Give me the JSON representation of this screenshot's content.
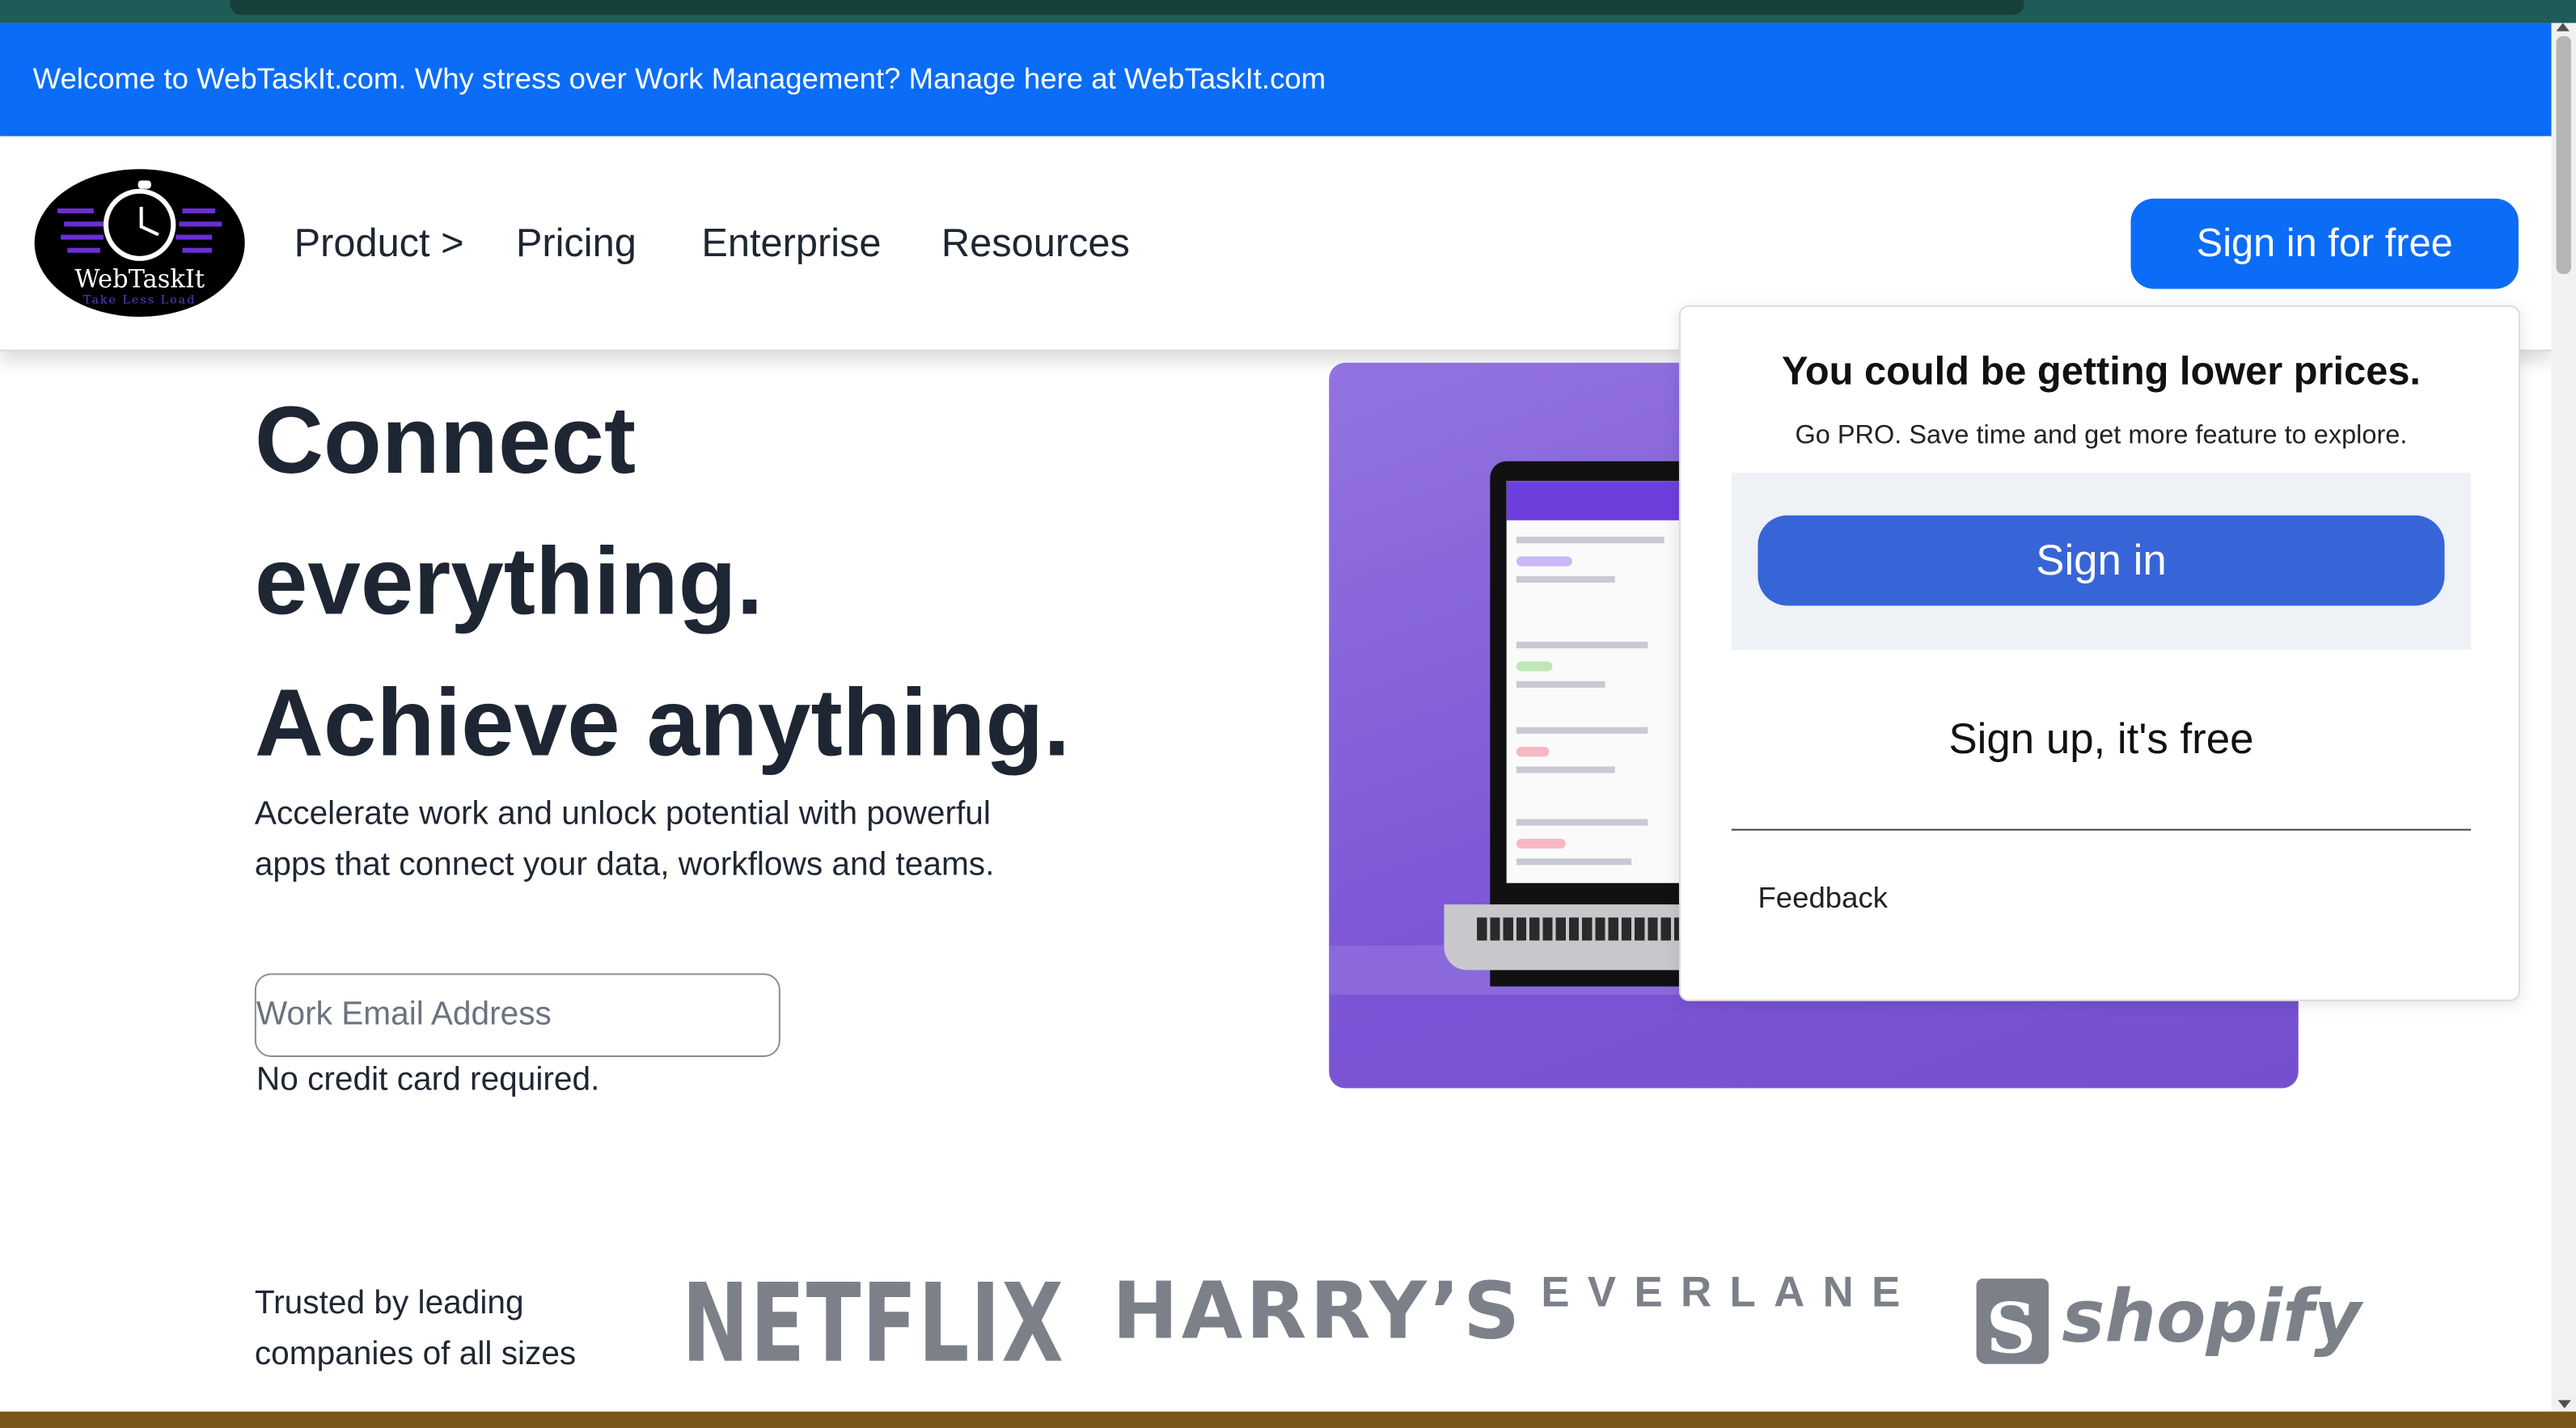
{
  "banner": {
    "text": "Welcome to WebTaskIt.com. Why stress over Work Management? Manage here at WebTaskIt.com"
  },
  "header": {
    "logo_name": "WebTaskIt",
    "logo_tagline": "Take Less Load",
    "nav": {
      "product": "Product >",
      "pricing": "Pricing",
      "enterprise": "Enterprise",
      "resources": "Resources"
    },
    "signin_button": "Sign in for free"
  },
  "hero": {
    "title_lines": [
      "Connect",
      "everything.",
      "Achieve anything."
    ],
    "subtitle": "Accelerate work and unlock potential with powerful apps that connect your data, workflows and teams.",
    "email_placeholder": "Work Email Address",
    "note": "No credit card required."
  },
  "popup": {
    "title": "You could be getting lower prices.",
    "subtitle": "Go PRO. Save time and get more feature to explore.",
    "signin": "Sign in",
    "signup": "Sign up, it's free",
    "feedback": "Feedback"
  },
  "trusted": {
    "label": "Trusted by leading companies of all sizes",
    "brands": {
      "netflix": "NETFLIX",
      "harrys": "HARRY’S",
      "everlane": "EVERLANE",
      "shopify": "shopify"
    }
  },
  "colors": {
    "brand_blue": "#0b6cf7",
    "popup_button": "#3765d8",
    "hero_panel": "#7b55d6",
    "logo_gray": "#7c8089"
  }
}
